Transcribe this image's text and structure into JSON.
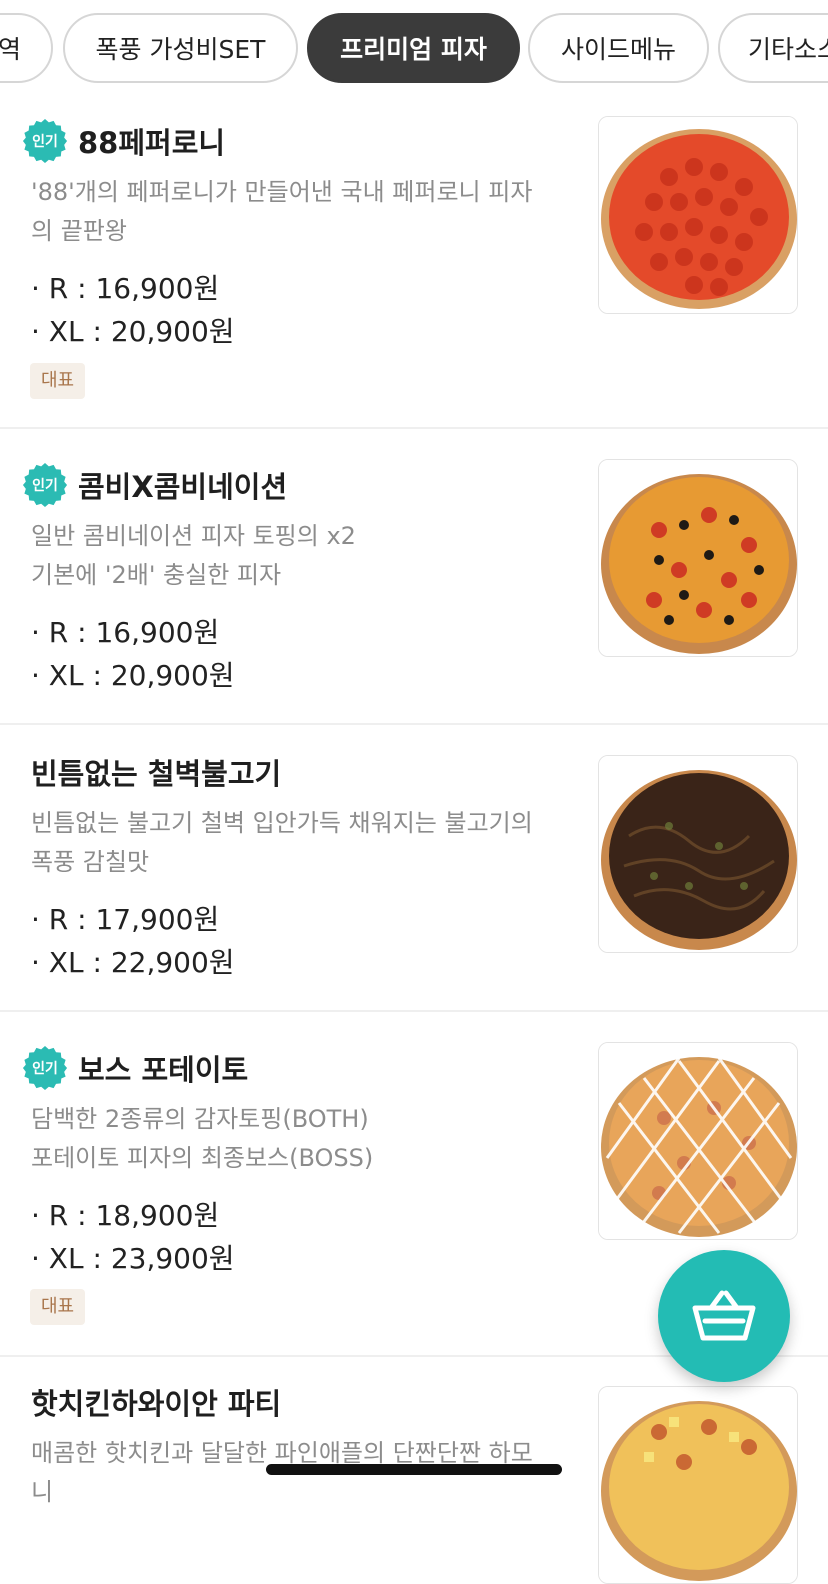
{
  "tabs": [
    {
      "label": "역",
      "active": false
    },
    {
      "label": "폭풍 가성비SET",
      "active": false
    },
    {
      "label": "프리미엄 피자",
      "active": true
    },
    {
      "label": "사이드메뉴",
      "active": false
    },
    {
      "label": "기타소스",
      "active": false
    }
  ],
  "popular_badge": "인기",
  "menu": [
    {
      "name": "88페퍼로니",
      "popular": true,
      "desc_lines": [
        "'88'개의 페퍼로니가 만들어낸 국내 페퍼로니 피자",
        "의 끝판왕"
      ],
      "price_r": "· R : 16,900원",
      "price_xl": "· XL : 20,900원",
      "tag": "대표",
      "image": "pepperoni-pizza-image"
    },
    {
      "name": "콤비X콤비네이션",
      "popular": true,
      "desc_lines": [
        "일반 콤비네이션 피자 토핑의 x2",
        "기본에 '2배' 충실한 피자"
      ],
      "price_r": "· R : 16,900원",
      "price_xl": "· XL : 20,900원",
      "tag": null,
      "image": "combination-pizza-image"
    },
    {
      "name": "빈틈없는 철벽불고기",
      "popular": false,
      "desc_lines": [
        "빈틈없는 불고기 철벽 입안가득 채워지는 불고기의",
        "폭풍 감칠맛"
      ],
      "price_r": "· R : 17,900원",
      "price_xl": "· XL : 22,900원",
      "tag": null,
      "image": "bulgogi-pizza-image"
    },
    {
      "name": "보스 포테이토",
      "popular": true,
      "desc_lines": [
        "담백한 2종류의 감자토핑(BOTH)",
        "포테이토 피자의 최종보스(BOSS)"
      ],
      "price_r": "· R : 18,900원",
      "price_xl": "· XL : 23,900원",
      "tag": "대표",
      "image": "potato-pizza-image"
    },
    {
      "name": "핫치킨하와이안 파티",
      "popular": false,
      "desc_lines": [
        "매콤한 핫치킨과 달달한 파인애플의 단짠단짠 하모",
        "니"
      ],
      "price_r": "",
      "price_xl": "",
      "tag": null,
      "image": "hawaiian-pizza-image"
    }
  ],
  "cart_icon": "shopping-basket-icon",
  "accent_color": "#23bcb4"
}
